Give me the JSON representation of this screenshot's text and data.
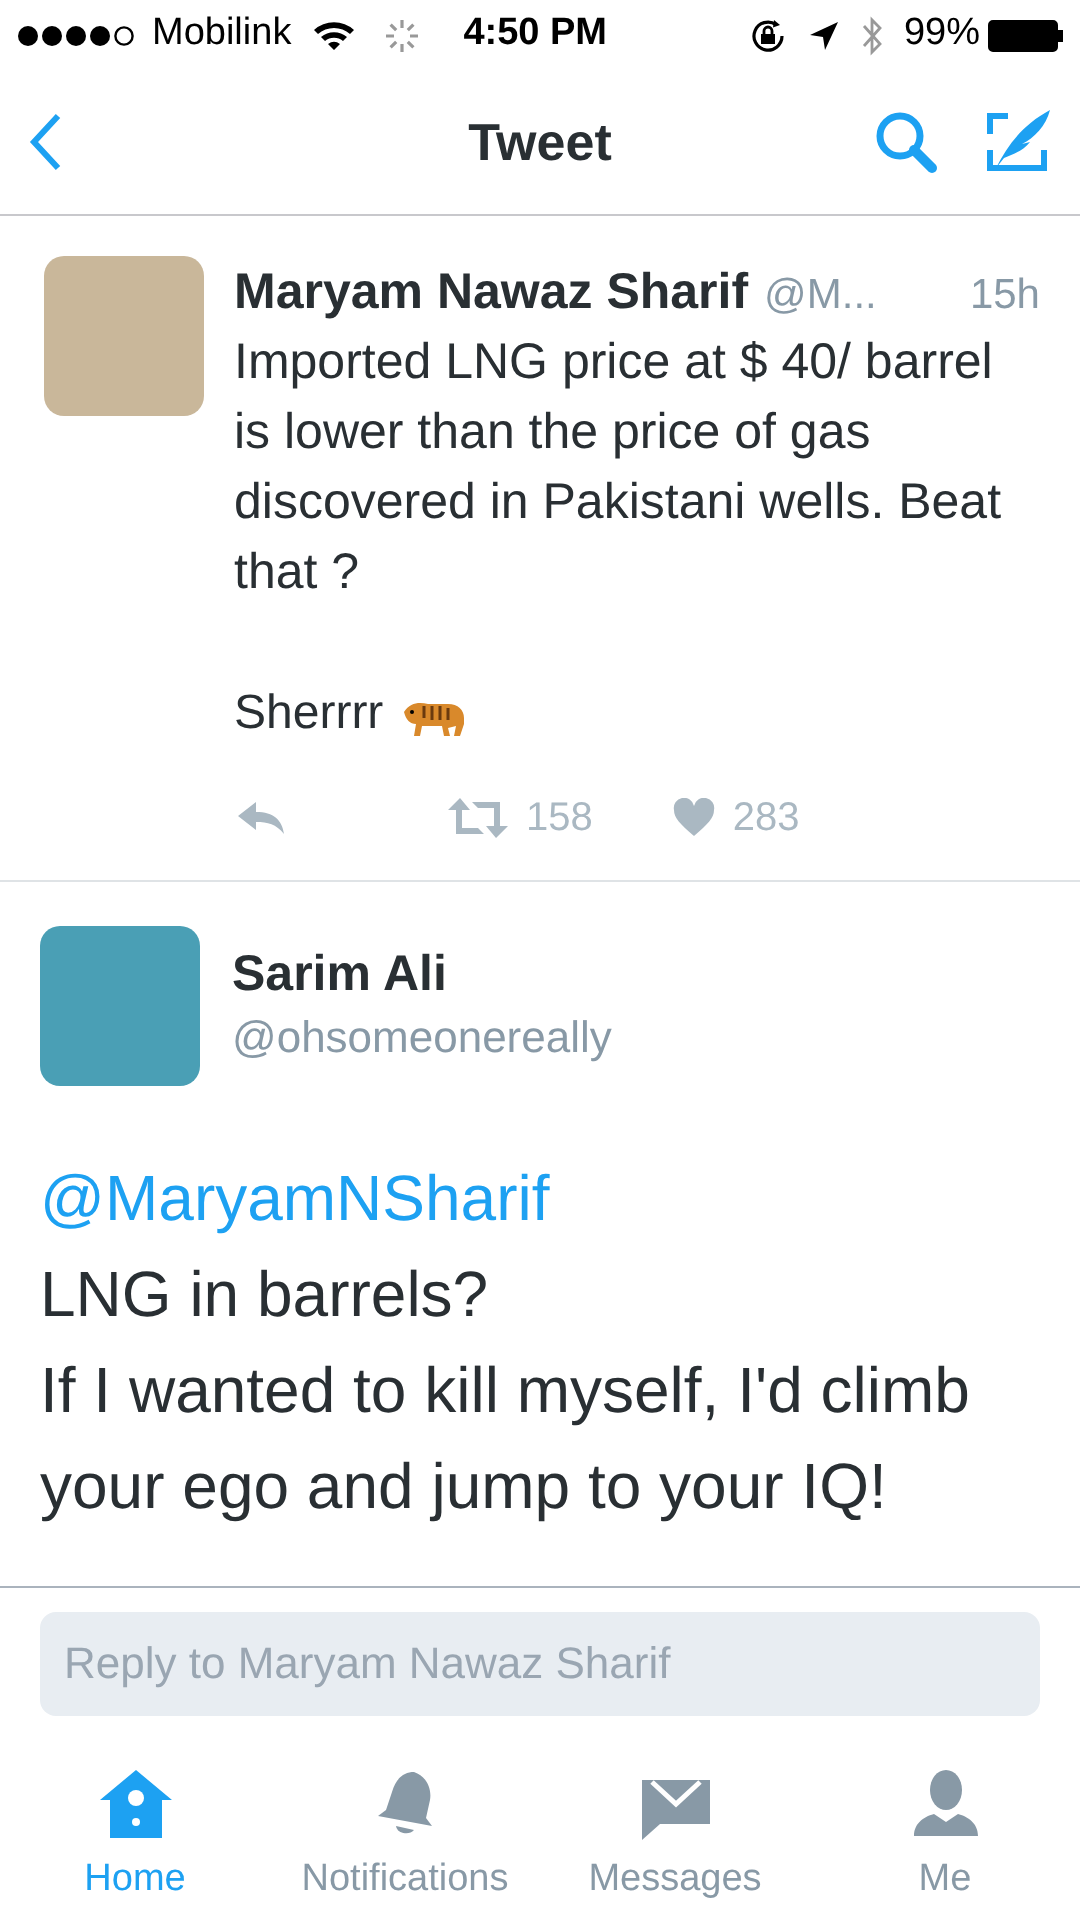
{
  "status_bar": {
    "carrier": "Mobilink",
    "time": "4:50 PM",
    "battery": "99%"
  },
  "nav": {
    "title": "Tweet"
  },
  "parent_tweet": {
    "name": "Maryam Nawaz Sharif",
    "handle": "@M...",
    "time": "15h",
    "text": "Imported LNG price at $ 40/ barrel is lower than the price of gas discovered in Pakistani wells. Beat that ?",
    "signoff": "Sherrrr",
    "retweets": "158",
    "likes": "283"
  },
  "main_tweet": {
    "name": "Sarim Ali",
    "handle": "@ohsomeonereally",
    "mention": "@MaryamNSharif",
    "text": " LNG in barrels?",
    "text_2": "If I wanted to kill myself, I'd climb your ego and jump to your IQ!"
  },
  "reply": {
    "placeholder": "Reply to Maryam Nawaz Sharif"
  },
  "tabs": [
    {
      "kind": "home",
      "label": "Home",
      "selected": true
    },
    {
      "kind": "notifications",
      "label": "Notifications",
      "selected": false
    },
    {
      "kind": "messages",
      "label": "Messages",
      "selected": false
    },
    {
      "kind": "me",
      "label": "Me",
      "selected": false
    }
  ]
}
